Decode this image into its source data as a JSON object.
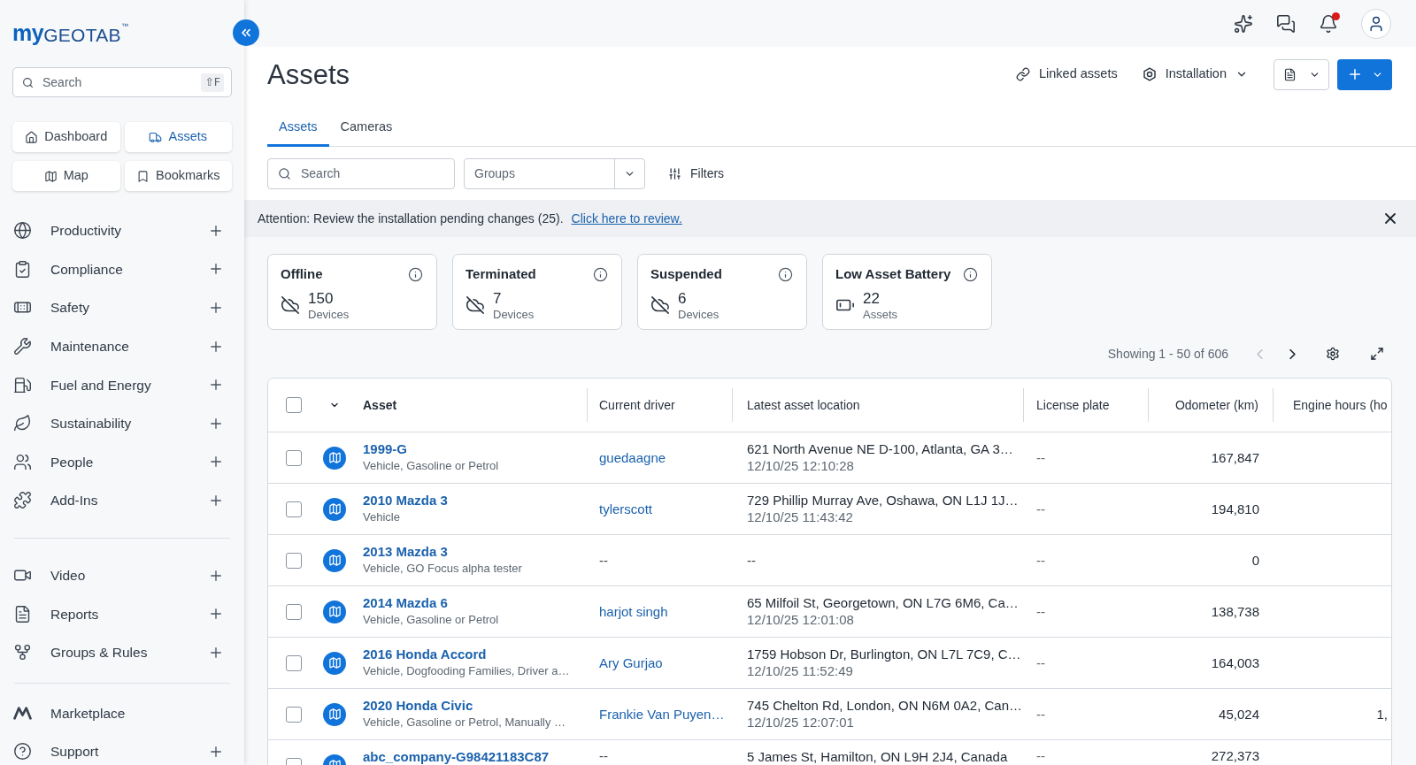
{
  "sidebar": {
    "logo": {
      "prefix": "my",
      "name": "GEOTAB",
      "mark": "™"
    },
    "search": {
      "placeholder": "Search",
      "shortcut": "⇧F"
    },
    "quick_links": [
      {
        "label": "Dashboard",
        "selected": false
      },
      {
        "label": "Assets",
        "selected": true
      },
      {
        "label": "Map",
        "selected": false
      },
      {
        "label": "Bookmarks",
        "selected": false
      }
    ],
    "nav_sections": [
      {
        "items": [
          {
            "label": "Productivity",
            "expandable": true
          },
          {
            "label": "Compliance",
            "expandable": true
          },
          {
            "label": "Safety",
            "expandable": true
          },
          {
            "label": "Maintenance",
            "expandable": true
          },
          {
            "label": "Fuel and Energy",
            "expandable": true
          },
          {
            "label": "Sustainability",
            "expandable": true
          },
          {
            "label": "People",
            "expandable": true
          },
          {
            "label": "Add-Ins",
            "expandable": true
          }
        ]
      },
      {
        "items": [
          {
            "label": "Video",
            "expandable": true
          },
          {
            "label": "Reports",
            "expandable": true
          },
          {
            "label": "Groups & Rules",
            "expandable": true
          }
        ]
      },
      {
        "items": [
          {
            "label": "Marketplace",
            "expandable": false
          },
          {
            "label": "Support",
            "expandable": true
          }
        ]
      }
    ]
  },
  "top_bar": {
    "notifications": {
      "unread": true
    }
  },
  "page": {
    "title": "Assets",
    "actions": [
      {
        "label": "Linked assets",
        "kind": "link"
      },
      {
        "label": "Installation",
        "kind": "menu"
      }
    ]
  },
  "tabs": [
    {
      "label": "Assets",
      "selected": true
    },
    {
      "label": "Cameras",
      "selected": false
    }
  ],
  "toolbar": {
    "search": {
      "placeholder": "Search"
    },
    "groups": {
      "placeholder": "Groups"
    },
    "filters": {
      "label": "Filters"
    }
  },
  "banner": {
    "text": "Attention: Review the installation pending changes (25).",
    "link": "Click here to review."
  },
  "summary_cards": [
    {
      "title": "Offline",
      "count": "150",
      "unit": "Devices",
      "kind": "connection"
    },
    {
      "title": "Terminated",
      "count": "7",
      "unit": "Devices",
      "kind": "connection"
    },
    {
      "title": "Suspended",
      "count": "6",
      "unit": "Devices",
      "kind": "connection"
    },
    {
      "title": "Low Asset Battery",
      "count": "22",
      "unit": "Assets",
      "kind": "battery"
    }
  ],
  "pagination": {
    "label": "Showing 1 - 50 of 606",
    "prev_disabled": true,
    "next_disabled": false
  },
  "table": {
    "select_all": {
      "checked": false
    },
    "columns": [
      "Asset",
      "Current driver",
      "Latest asset location",
      "License plate",
      "Odometer (km)",
      "Engine hours (ho"
    ],
    "rows": [
      {
        "checked": false,
        "asset": "1999-G",
        "asset_type": "Vehicle, Gasoline or Petrol",
        "driver": {
          "name": "guedaagne",
          "linked": true
        },
        "location": "621 North Avenue NE D-100, Atlanta, GA 3…",
        "time": "12/10/25 12:10:28",
        "license_plate": "--",
        "odometer": "167,847"
      },
      {
        "checked": false,
        "asset": "2010 Mazda 3",
        "asset_type": "Vehicle",
        "driver": {
          "name": "tylerscott",
          "linked": true
        },
        "location": "729 Phillip Murray Ave, Oshawa, ON L1J 1J…",
        "time": "12/10/25 11:43:42",
        "license_plate": "--",
        "odometer": "194,810"
      },
      {
        "checked": false,
        "asset": "2013 Mazda 3",
        "asset_type": "Vehicle, GO Focus alpha tester",
        "driver": {
          "name": "--",
          "linked": false
        },
        "location": "--",
        "license_plate": "--",
        "odometer": "0"
      },
      {
        "checked": false,
        "asset": "2014 Mazda 6",
        "asset_type": "Vehicle, Gasoline or Petrol",
        "driver": {
          "name": "harjot singh",
          "linked": true
        },
        "location": "65 Milfoil St, Georgetown, ON L7G 6M6, Ca…",
        "time": "12/10/25 12:01:08",
        "license_plate": "--",
        "odometer": "138,738"
      },
      {
        "checked": false,
        "asset": "2016 Honda Accord",
        "asset_type": "Vehicle, Dogfooding Families, Driver a…",
        "driver": {
          "name": "Ary Gurjao",
          "linked": true
        },
        "location": "1759 Hobson Dr, Burlington, ON L7L 7C9, C…",
        "time": "12/10/25 11:52:49",
        "license_plate": "--",
        "odometer": "164,003"
      },
      {
        "checked": false,
        "asset": "2020 Honda Civic",
        "asset_type": "Vehicle, Gasoline or Petrol, Manually …",
        "driver": {
          "name": "Frankie Van Puyen…",
          "linked": true
        },
        "location": "745 Chelton Rd, London, ON N6M 0A2, Can…",
        "time": "12/10/25 12:07:01",
        "license_plate": "--",
        "odometer": "45,024",
        "engine_hours": "1,"
      },
      {
        "checked": false,
        "asset": "abc_company-G98421183C87",
        "driver": {
          "name": "--",
          "linked": false
        },
        "location": "5 James St, Hamilton, ON L9H 2J4, Canada",
        "license_plate": "--",
        "odometer": "272,373"
      }
    ]
  }
}
